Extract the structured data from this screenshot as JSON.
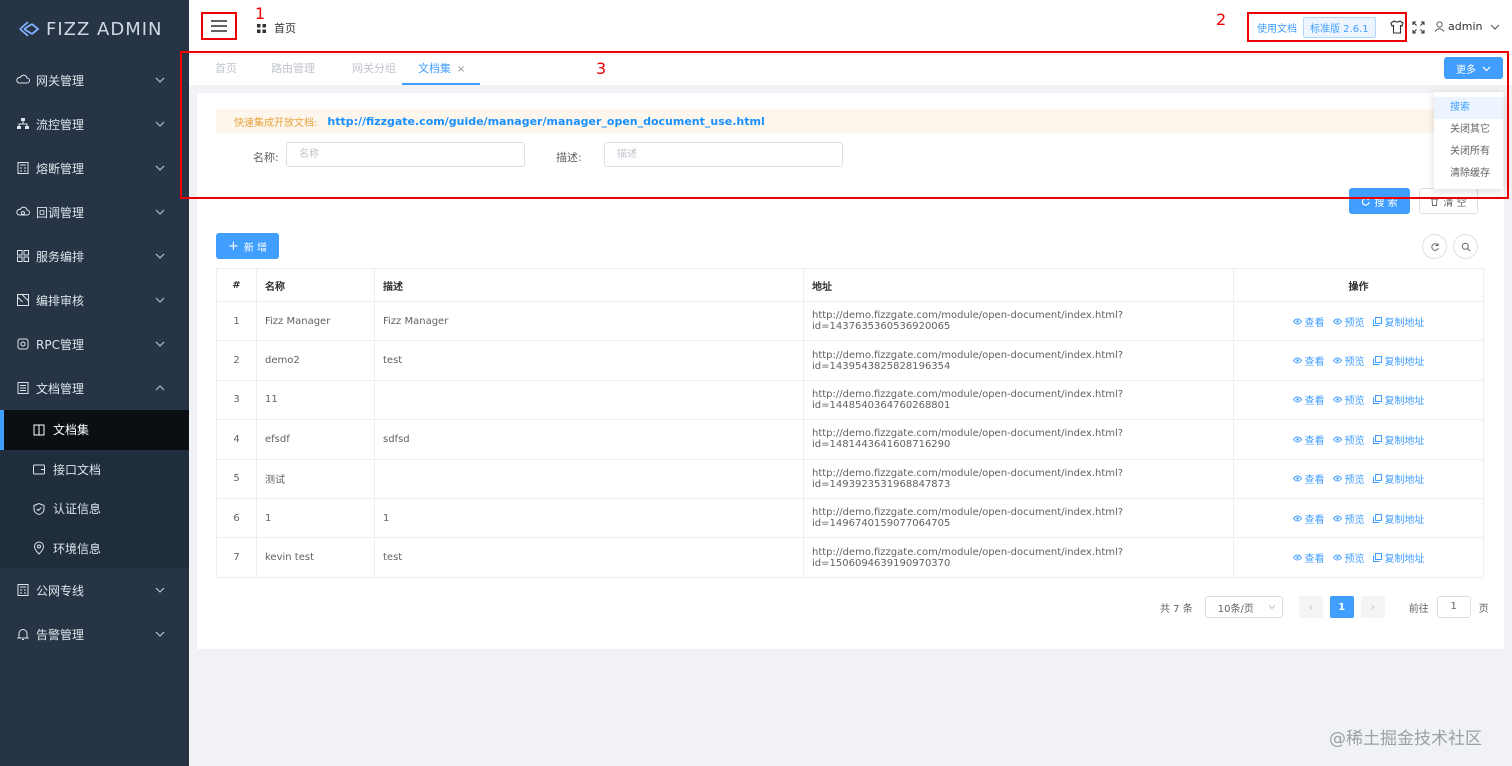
{
  "app": {
    "logo_text": "FIZZ ADMIN"
  },
  "sidebar": {
    "items": [
      {
        "label": "网关管理",
        "icon": "cloud-icon"
      },
      {
        "label": "流控管理",
        "icon": "sitemap-icon"
      },
      {
        "label": "熔断管理",
        "icon": "calculator-icon"
      },
      {
        "label": "回调管理",
        "icon": "cloud-callback-icon"
      },
      {
        "label": "服务编排",
        "icon": "grid-icon"
      },
      {
        "label": "编排审核",
        "icon": "picture-icon"
      },
      {
        "label": "RPC管理",
        "icon": "link-icon"
      },
      {
        "label": "文档管理",
        "icon": "doc-list-icon"
      }
    ],
    "sub_items": [
      {
        "label": "文档集",
        "icon": "book-icon"
      },
      {
        "label": "接口文档",
        "icon": "wallet-icon"
      },
      {
        "label": "认证信息",
        "icon": "shield-icon"
      },
      {
        "label": "环境信息",
        "icon": "location-icon"
      }
    ],
    "items_after": [
      {
        "label": "公网专线",
        "icon": "calculator-icon"
      },
      {
        "label": "告警管理",
        "icon": "bell-icon"
      }
    ]
  },
  "header": {
    "breadcrumb": "首页",
    "doc_link": "使用文档",
    "version": "标准版 2.6.1",
    "user": "admin",
    "annotations": [
      "1",
      "2",
      "3"
    ]
  },
  "tabs": [
    {
      "label": "首页"
    },
    {
      "label": "路由管理"
    },
    {
      "label": "网关分组"
    },
    {
      "label": "文档集",
      "active": true,
      "close": "×"
    }
  ],
  "more": {
    "label": "更多",
    "menu": [
      "搜索",
      "关闭其它",
      "关闭所有",
      "清除缓存"
    ]
  },
  "notice": {
    "label": "快速集成开放文档:",
    "link": "http://fizzgate.com/guide/manager/manager_open_document_use.html"
  },
  "form": {
    "name_label": "名称:",
    "name_placeholder": "名称",
    "desc_label": "描述:",
    "desc_placeholder": "描述",
    "search_label": "搜 索",
    "clear_label": "清 空",
    "add_label": "新 增"
  },
  "table": {
    "headers": [
      "#",
      "名称",
      "描述",
      "地址",
      "操作"
    ],
    "ops": [
      "查看",
      "预览",
      "复制地址"
    ],
    "rows": [
      [
        "1",
        "Fizz Manager",
        "Fizz Manager",
        "http://demo.fizzgate.com/module/open-document/index.html?id=1437635360536920065"
      ],
      [
        "2",
        "demo2",
        "test",
        "http://demo.fizzgate.com/module/open-document/index.html?id=1439543825828196354"
      ],
      [
        "3",
        "11",
        "",
        "http://demo.fizzgate.com/module/open-document/index.html?id=1448540364760268801"
      ],
      [
        "4",
        "efsdf",
        "sdfsd",
        "http://demo.fizzgate.com/module/open-document/index.html?id=1481443641608716290"
      ],
      [
        "5",
        "测试",
        "",
        "http://demo.fizzgate.com/module/open-document/index.html?id=1493923531968847873"
      ],
      [
        "6",
        "1",
        "1",
        "http://demo.fizzgate.com/module/open-document/index.html?id=1496740159077064705"
      ],
      [
        "7",
        "kevin test",
        "test",
        "http://demo.fizzgate.com/module/open-document/index.html?id=1506094639190970370"
      ]
    ]
  },
  "pager": {
    "total": "共 7 条",
    "size": "10条/页",
    "prev": "‹",
    "page": "1",
    "next": "›",
    "goto": "前往",
    "goto_value": "1",
    "page_suffix": "页"
  },
  "watermark": "@稀土掘金技术社区",
  "colors": {
    "primary": "#409eff",
    "sidebar": "#263445",
    "annotation": "#e00000"
  }
}
